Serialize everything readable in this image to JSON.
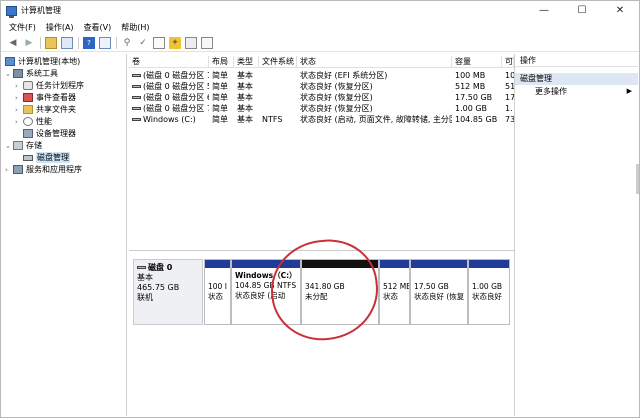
{
  "window": {
    "title": "计算机管理",
    "minimize": "—",
    "maximize": "☐",
    "close": "✕"
  },
  "menu": [
    "文件(F)",
    "操作(A)",
    "查看(V)",
    "帮助(H)"
  ],
  "tree": {
    "root": "计算机管理(本地)",
    "system_tools": "系统工具",
    "task_scheduler": "任务计划程序",
    "event_viewer": "事件查看器",
    "shared_folders": "共享文件夹",
    "performance": "性能",
    "device_manager": "设备管理器",
    "storage": "存储",
    "disk_management": "磁盘管理",
    "services_apps": "服务和应用程序"
  },
  "volume_list": {
    "headers": [
      "卷",
      "布局",
      "类型",
      "文件系统",
      "状态",
      "容量",
      "可用"
    ],
    "rows": [
      [
        "(磁盘 0 磁盘分区 1)",
        "简单",
        "基本",
        "",
        "状态良好 (EFI 系统分区)",
        "100 MB",
        "10"
      ],
      [
        "(磁盘 0 磁盘分区 5)",
        "简单",
        "基本",
        "",
        "状态良好 (恢复分区)",
        "512 MB",
        "51"
      ],
      [
        "(磁盘 0 磁盘分区 6)",
        "简单",
        "基本",
        "",
        "状态良好 (恢复分区)",
        "17.50 GB",
        "17"
      ],
      [
        "(磁盘 0 磁盘分区 7)",
        "简单",
        "基本",
        "",
        "状态良好 (恢复分区)",
        "1.00 GB",
        "1."
      ],
      [
        "Windows (C:)",
        "简单",
        "基本",
        "NTFS",
        "状态良好 (启动, 页面文件, 故障转储, 主分区)",
        "104.85 GB",
        "73"
      ]
    ]
  },
  "disk": {
    "name": "磁盘 0",
    "type": "基本",
    "size": "465.75 GB",
    "status": "联机",
    "partitions": [
      {
        "size": "100 I",
        "status": "状态"
      },
      {
        "label": "Windows（C:）",
        "size": "104.85 GB NTFS",
        "status": "状态良好 (启动"
      },
      {
        "size": "341.80 GB",
        "status": "未分配"
      },
      {
        "size": "512 ME",
        "status": "状态"
      },
      {
        "size": "17.50 GB",
        "status": "状态良好 (恢复"
      },
      {
        "size": "1.00 GB",
        "status": "状态良好"
      }
    ]
  },
  "actions": {
    "header": "操作",
    "section": "磁盘管理",
    "more": "更多操作"
  },
  "colors": {
    "primary_bar": "#1f3d97",
    "unallocated_bar": "#111111",
    "annotation": "#c8313a"
  }
}
